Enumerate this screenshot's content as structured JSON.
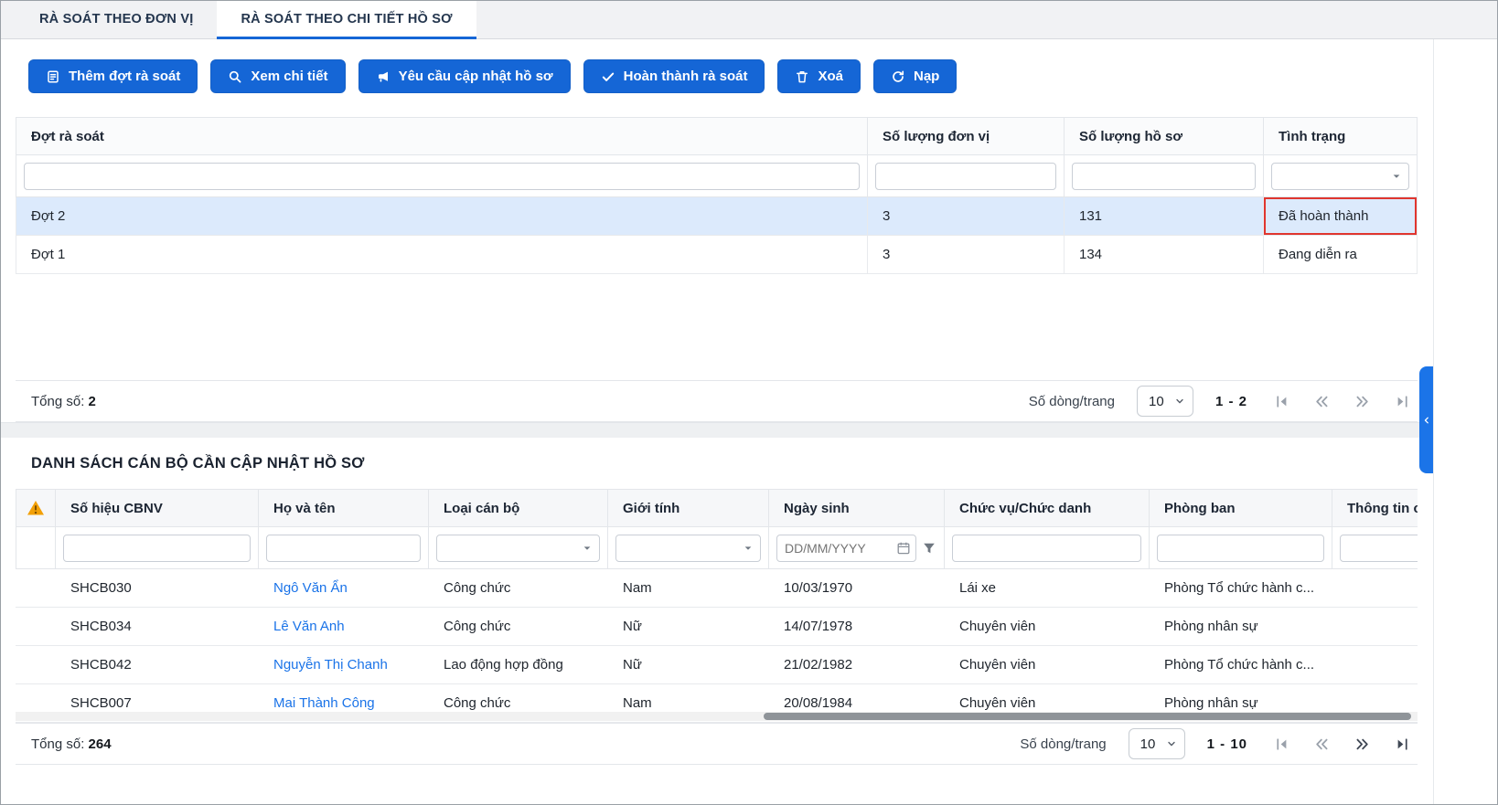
{
  "tabs": [
    {
      "label": "RÀ SOÁT THEO ĐƠN VỊ"
    },
    {
      "label": "RÀ SOÁT THEO CHI TIẾT HỒ SƠ"
    }
  ],
  "toolbar": {
    "add_label": "Thêm đợt rà soát",
    "view_label": "Xem chi tiết",
    "request_label": "Yêu cầu cập nhật hồ sơ",
    "complete_label": "Hoàn thành rà soát",
    "delete_label": "Xoá",
    "reload_label": "Nạp"
  },
  "icons": {
    "add": "document-icon",
    "view": "search-icon",
    "request": "megaphone-icon",
    "complete": "check-icon",
    "delete": "trash-icon",
    "reload": "refresh-icon",
    "warning": "warning-triangle-icon",
    "collapse": "chevron-left-icon"
  },
  "review_table": {
    "columns": {
      "period": "Đợt rà soát",
      "unit_count": "Số lượng đơn vị",
      "record_count": "Số lượng hồ sơ",
      "status": "Tình trạng"
    },
    "rows": [
      {
        "period": "Đợt 2",
        "unit_count": "3",
        "record_count": "131",
        "status": "Đã hoàn thành",
        "selected": true,
        "status_highlighted": true
      },
      {
        "period": "Đợt 1",
        "unit_count": "3",
        "record_count": "134",
        "status": "Đang diễn ra",
        "selected": false,
        "status_highlighted": false
      }
    ],
    "footer": {
      "total_label": "Tổng số:",
      "total_value": "2",
      "page_size_label": "Số dòng/trang",
      "page_size": "10",
      "page_range": "1 - 2"
    }
  },
  "staff_table": {
    "title": "DANH SÁCH CÁN BỘ CẦN CẬP NHẬT HỒ SƠ",
    "columns": {
      "code": "Số hiệu CBNV",
      "name": "Họ và tên",
      "type": "Loại cán bộ",
      "gender": "Giới tính",
      "dob": "Ngày sinh",
      "position": "Chức vụ/Chức danh",
      "department": "Phòng ban",
      "info": "Thông tin c"
    },
    "filters": {
      "dob_placeholder": "DD/MM/YYYY"
    },
    "rows": [
      {
        "code": "SHCB030",
        "name": "Ngô Văn Ẩn",
        "type": "Công chức",
        "gender": "Nam",
        "dob": "10/03/1970",
        "position": "Lái xe",
        "department": "Phòng Tổ chức hành c..."
      },
      {
        "code": "SHCB034",
        "name": "Lê Văn Anh",
        "type": "Công chức",
        "gender": "Nữ",
        "dob": "14/07/1978",
        "position": "Chuyên viên",
        "department": "Phòng nhân sự"
      },
      {
        "code": "SHCB042",
        "name": "Nguyễn Thị Chanh",
        "type": "Lao động hợp đồng",
        "gender": "Nữ",
        "dob": "21/02/1982",
        "position": "Chuyên viên",
        "department": "Phòng Tổ chức hành c..."
      },
      {
        "code": "SHCB007",
        "name": "Mai Thành Công",
        "type": "Công chức",
        "gender": "Nam",
        "dob": "20/08/1984",
        "position": "Chuyên viên",
        "department": "Phòng nhân sự"
      }
    ],
    "footer": {
      "total_label": "Tổng số:",
      "total_value": "264",
      "page_size_label": "Số dòng/trang",
      "page_size": "10",
      "page_range": "1 - 10"
    }
  },
  "colors": {
    "accent": "#1566d6",
    "highlight_border": "#e0362f",
    "selected_row": "#dceafc",
    "link": "#1a73e8",
    "warning": "#f2a007"
  }
}
